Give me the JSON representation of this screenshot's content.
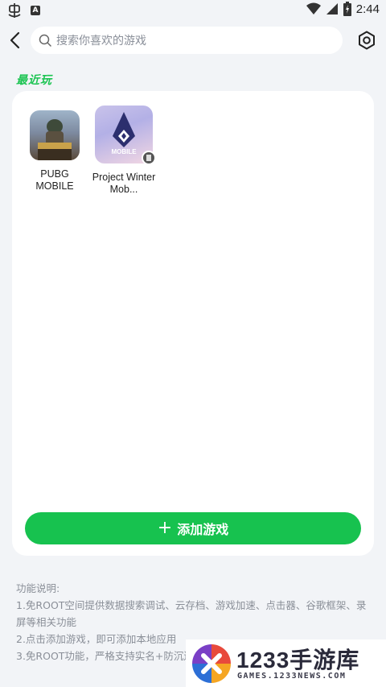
{
  "status_bar": {
    "time": "2:44"
  },
  "search": {
    "placeholder": "搜索你喜欢的游戏"
  },
  "recent": {
    "title": "最近玩",
    "games": [
      {
        "name": "PUBG MOBILE"
      },
      {
        "name": "Project Winter Mob..."
      }
    ],
    "game_icon_texts": {
      "project_winter": "MOBILE"
    }
  },
  "add_button": {
    "label": "添加游戏"
  },
  "notes": {
    "title": "功能说明:",
    "items": [
      "1.免ROOT空间提供数据搜索调试、云存档、游戏加速、点击器、谷歌框架、录屏等相关功能",
      "2.点击添加游戏，即可添加本地应用",
      "3.免ROOT功能，严格支持实名+防沉迷"
    ]
  },
  "watermark": {
    "title": "1233手游库",
    "subtitle": "GAMES.1233NEWS.COM"
  },
  "colors": {
    "accent": "#17c24f",
    "background": "#f2f4f7"
  }
}
